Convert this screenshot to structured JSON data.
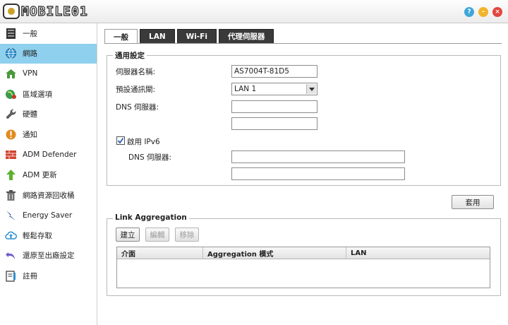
{
  "app": {
    "logo_text": "MOBILE01",
    "window_buttons": {
      "help": "?",
      "minimize": "–",
      "close": "×"
    }
  },
  "sidebar": {
    "items": [
      {
        "label": "一般",
        "icon": "server-icon",
        "active": false
      },
      {
        "label": "網路",
        "icon": "globe-icon",
        "active": true
      },
      {
        "label": "VPN",
        "icon": "house-network-icon",
        "active": false
      },
      {
        "label": "區域選項",
        "icon": "region-map-icon",
        "active": false
      },
      {
        "label": "硬體",
        "icon": "wrench-icon",
        "active": false
      },
      {
        "label": "通知",
        "icon": "alert-icon",
        "active": false
      },
      {
        "label": "ADM Defender",
        "icon": "firewall-icon",
        "active": false
      },
      {
        "label": "ADM 更新",
        "icon": "arrow-up-icon",
        "active": false
      },
      {
        "label": "網路資源回收桶",
        "icon": "trash-icon",
        "active": false
      },
      {
        "label": "Energy Saver",
        "icon": "lightning-icon",
        "active": false
      },
      {
        "label": "輕鬆存取",
        "icon": "cloud-icon",
        "active": false
      },
      {
        "label": "還原至出廠設定",
        "icon": "undo-icon",
        "active": false
      },
      {
        "label": "註冊",
        "icon": "register-icon",
        "active": false
      }
    ]
  },
  "tabs": [
    {
      "label": "一般",
      "active": true
    },
    {
      "label": "LAN",
      "active": false
    },
    {
      "label": "Wi-Fi",
      "active": false
    },
    {
      "label": "代理伺服器",
      "active": false
    }
  ],
  "general_settings": {
    "title": "通用設定",
    "server_name_label": "伺服器名稱:",
    "server_name_value": "AS7004T-81D5",
    "gateway_label": "預設通訊閘:",
    "gateway_value": "LAN 1",
    "dns_label": "DNS 伺服器:",
    "dns1_value": "",
    "dns2_value": "",
    "ipv6_enable_label": "啟用 IPv6",
    "ipv6_enabled": true,
    "ipv6_dns_label": "DNS 伺服器:",
    "ipv6_dns1_value": "",
    "ipv6_dns2_value": ""
  },
  "apply_button": "套用",
  "link_aggregation": {
    "title": "Link Aggregation",
    "buttons": {
      "create": "建立",
      "edit": "編輯",
      "remove": "移除"
    },
    "columns": [
      "介面",
      "Aggregation 模式",
      "LAN"
    ],
    "rows": []
  }
}
